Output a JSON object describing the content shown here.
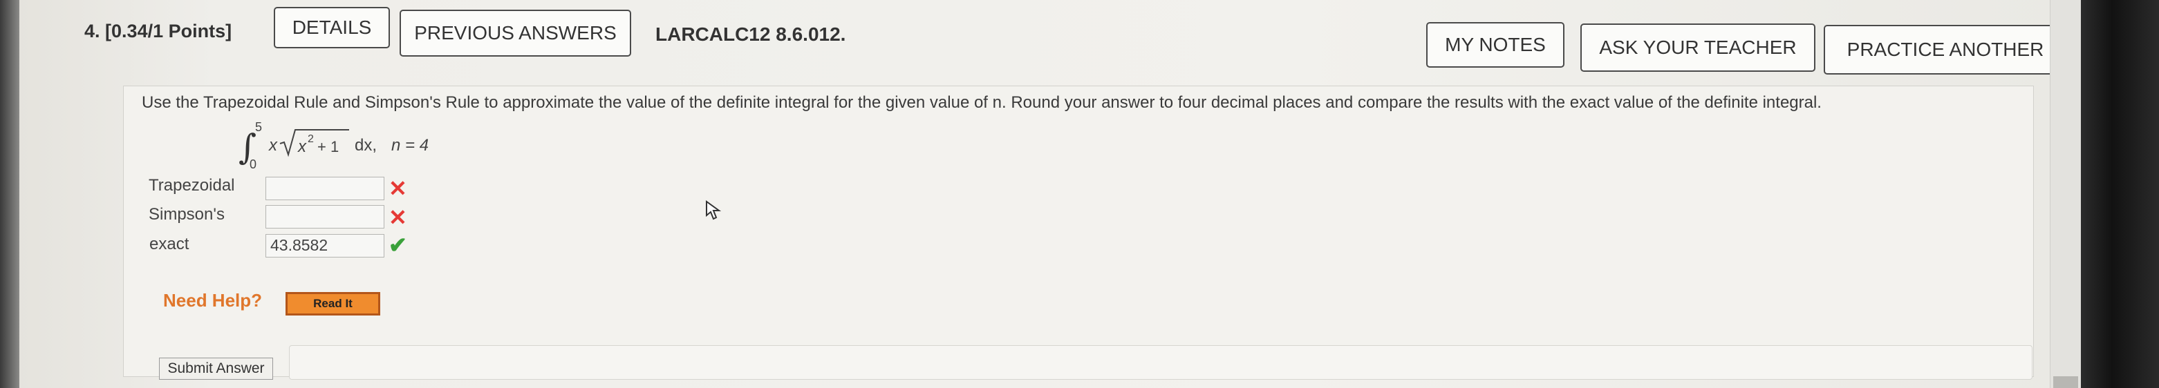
{
  "question": {
    "number_label": "4.",
    "points": "[0.34/1 Points]",
    "code": "LARCALC12 8.6.012."
  },
  "header_buttons": {
    "details": "DETAILS",
    "previous_answers": "PREVIOUS ANSWERS",
    "my_notes": "MY NOTES",
    "ask_teacher": "ASK YOUR TEACHER",
    "practice_another": "PRACTICE ANOTHER"
  },
  "instructions": "Use the Trapezoidal Rule and Simpson's Rule to approximate the value of the definite integral for the given value of n. Round your answer to four decimal places and compare the results with the exact value of the definite integral.",
  "integral": {
    "upper": "5",
    "lower": "0",
    "integrand_prefix": "x",
    "radicand": "x",
    "exponent": "2",
    "radicand_tail": "+ 1",
    "dx": "dx,",
    "n_part": "n = 4"
  },
  "rows": [
    {
      "label": "Trapezoidal",
      "value": "",
      "status": "incorrect"
    },
    {
      "label": "Simpson's",
      "value": "",
      "status": "incorrect"
    },
    {
      "label": "exact",
      "value": "43.8582",
      "status": "correct"
    }
  ],
  "marks": {
    "incorrect": "✕",
    "correct": "✔"
  },
  "help": {
    "need_help": "Need Help?",
    "read_it": "Read It"
  },
  "submit_label": "Submit Answer",
  "colors": {
    "incorrect": "#e53935",
    "correct": "#3aa13a",
    "help_orange": "#e0762b",
    "read_it_bg": "#f08c2e"
  }
}
